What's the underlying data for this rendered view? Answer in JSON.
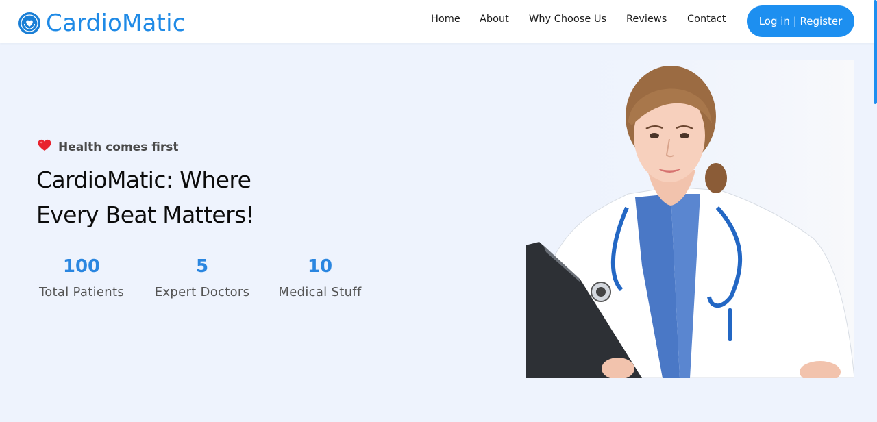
{
  "brand": {
    "name": "CardioMatic",
    "logo_icon": "heart-hands-icon"
  },
  "nav": {
    "items": [
      {
        "label": "Home"
      },
      {
        "label": "About"
      },
      {
        "label": "Why Choose Us"
      },
      {
        "label": "Reviews"
      },
      {
        "label": "Contact"
      }
    ],
    "login_label": "Log in | Register"
  },
  "hero": {
    "tagline_icon": "heart-icon",
    "tagline": "Health comes first",
    "headline_line1": "CardioMatic: Where",
    "headline_line2": "Every Beat Matters!",
    "stats": [
      {
        "value": "100",
        "label": "Total Patients"
      },
      {
        "value": "5",
        "label": "Expert Doctors"
      },
      {
        "value": "10",
        "label": "Medical Stuff"
      }
    ]
  },
  "colors": {
    "accent": "#1d8ff0",
    "brand_text": "#1f8ae6",
    "hero_background": "#eef3fd",
    "stat_value": "#2a86e0"
  }
}
